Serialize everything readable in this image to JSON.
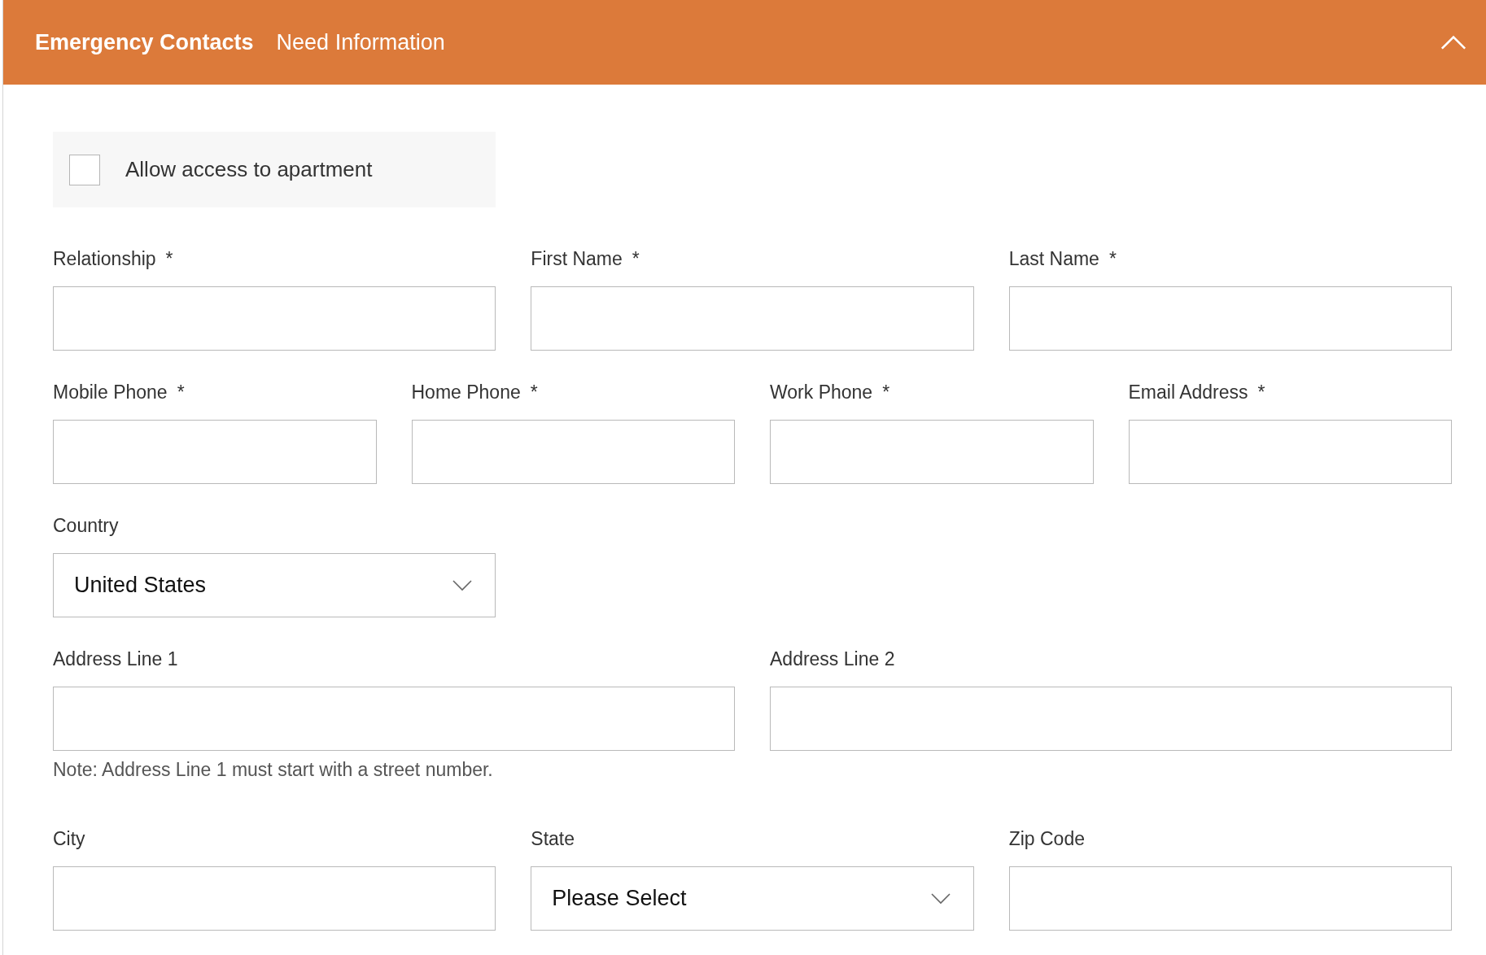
{
  "header": {
    "title": "Emergency Contacts",
    "status": "Need Information",
    "expanded": true
  },
  "access_checkbox": {
    "label": "Allow access to apartment",
    "checked": false
  },
  "rows": [
    {
      "fields": [
        {
          "kind": "text",
          "label": "Relationship",
          "required_mark": "*"
        },
        {
          "kind": "text",
          "label": "First Name",
          "required_mark": "*"
        },
        {
          "kind": "text",
          "label": "Last Name",
          "required_mark": "*"
        }
      ]
    },
    {
      "fields": [
        {
          "kind": "text",
          "label": "Mobile Phone",
          "required_mark": "*"
        },
        {
          "kind": "text",
          "label": "Home Phone",
          "required_mark": "*"
        },
        {
          "kind": "text",
          "label": "Work Phone",
          "required_mark": "*"
        },
        {
          "kind": "text",
          "label": "Email Address",
          "required_mark": "*"
        }
      ]
    },
    {
      "fields": [
        {
          "kind": "select",
          "label": "Country",
          "value": "United States"
        }
      ]
    },
    {
      "fields": [
        {
          "kind": "text",
          "label": "Address Line 1",
          "note": "Note: Address Line 1 must start with a street number."
        },
        {
          "kind": "text",
          "label": "Address Line 2"
        }
      ]
    },
    {
      "fields": [
        {
          "kind": "text",
          "label": "City"
        },
        {
          "kind": "select",
          "label": "State",
          "value": "Please Select"
        },
        {
          "kind": "text",
          "label": "Zip Code"
        }
      ]
    }
  ]
}
